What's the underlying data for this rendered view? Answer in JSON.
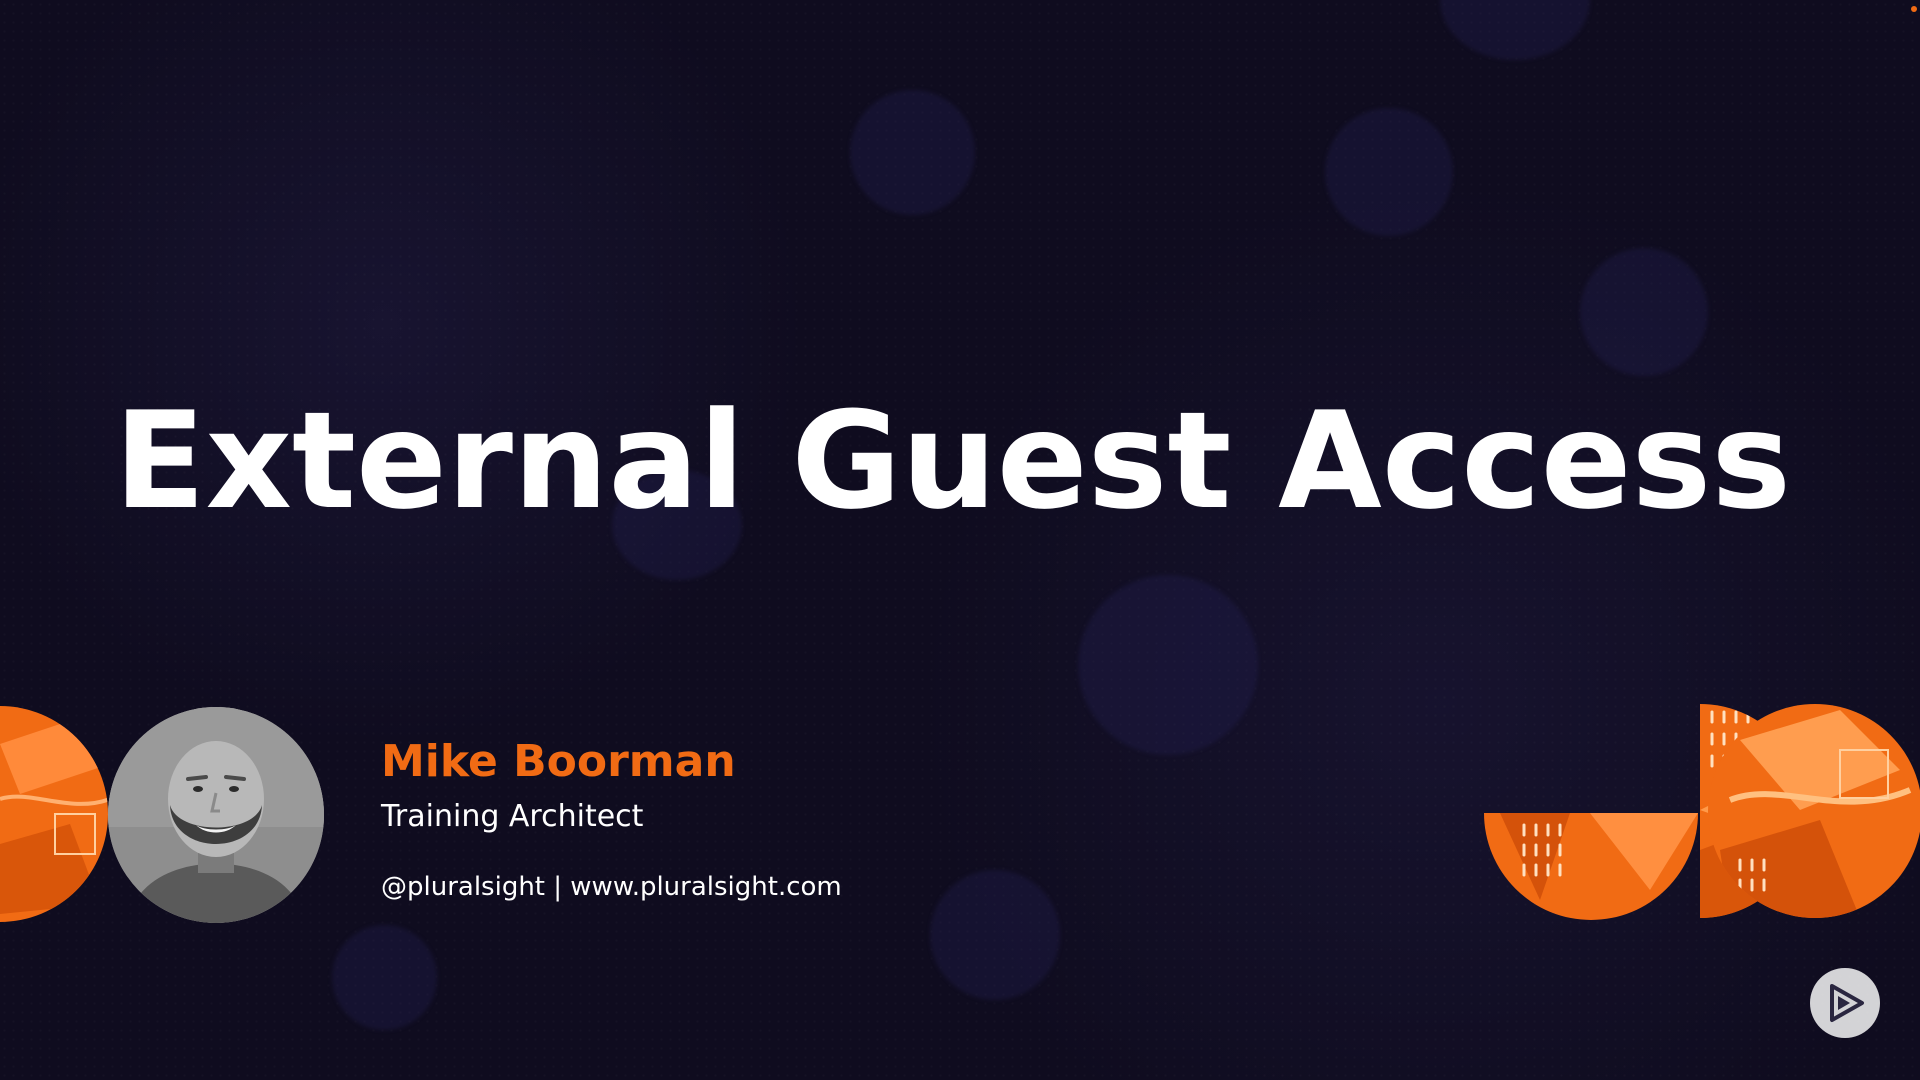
{
  "slide": {
    "title": "External Guest Access",
    "presenter": {
      "name": "Mike Boorman",
      "role": "Training Architect",
      "contact": "@pluralsight | www.pluralsight.com"
    }
  },
  "controls": {
    "play_icon": "play-icon"
  },
  "colors": {
    "background": "#0f0c1f",
    "accent": "#f16b14",
    "title": "#ffffff",
    "text": "#ffffff"
  }
}
